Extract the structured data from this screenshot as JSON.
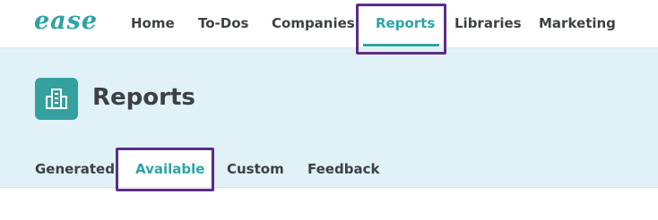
{
  "app": {
    "logo_text": "ease"
  },
  "nav": {
    "items": [
      {
        "label": "Home"
      },
      {
        "label": "To-Dos"
      },
      {
        "label": "Companies"
      },
      {
        "label": "Reports",
        "active": true
      },
      {
        "label": "Libraries"
      },
      {
        "label": "Marketing"
      }
    ]
  },
  "page": {
    "title": "Reports",
    "icon": "building-icon"
  },
  "sub_tabs": {
    "items": [
      {
        "label": "Generated"
      },
      {
        "label": "Available",
        "active": true
      },
      {
        "label": "Custom"
      },
      {
        "label": "Feedback"
      }
    ]
  },
  "colors": {
    "accent": "#2ea3a6",
    "header_background": "#e0f1f7",
    "highlight_outline": "#5c2d87",
    "text": "#3d4144"
  }
}
